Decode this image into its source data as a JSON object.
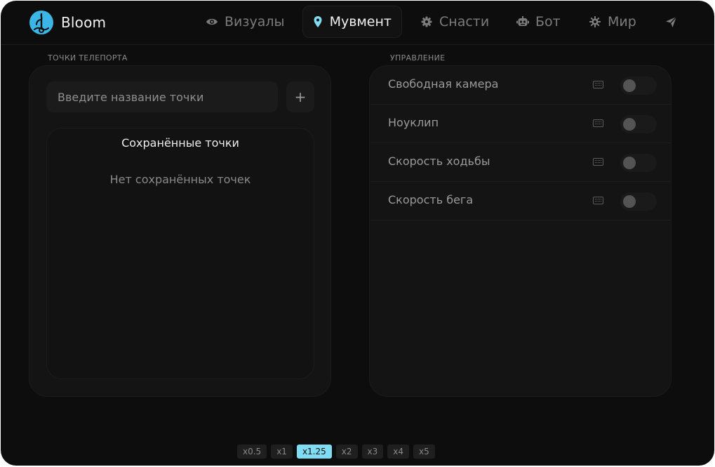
{
  "app": {
    "name": "Bloom"
  },
  "tabs": [
    {
      "label": "Визуалы",
      "icon": "eye-icon"
    },
    {
      "label": "Мувмент",
      "icon": "map-pin-icon",
      "active": true
    },
    {
      "label": "Снасти",
      "icon": "gear-icon"
    },
    {
      "label": "Бот",
      "icon": "robot-icon"
    },
    {
      "label": "Мир",
      "icon": "sun-gear-icon"
    },
    {
      "label": "",
      "icon": "send-icon"
    }
  ],
  "teleport": {
    "section_label": "ТОЧКИ ТЕЛЕПОРТА",
    "input_placeholder": "Введите название точки",
    "add_label": "+",
    "saved_title": "Сохранённые точки",
    "empty_text": "Нет сохранённых точек"
  },
  "controls": {
    "section_label": "УПРАВЛЕНИЕ",
    "items": [
      {
        "label": "Свободная камера",
        "enabled": false,
        "keybind_icon": "keyboard-icon"
      },
      {
        "label": "Ноуклип",
        "enabled": false,
        "keybind_icon": "keyboard-icon"
      },
      {
        "label": "Скорость ходьбы",
        "enabled": false,
        "keybind_icon": "keyboard-icon"
      },
      {
        "label": "Скорость бега",
        "enabled": false,
        "keybind_icon": "keyboard-icon"
      }
    ]
  },
  "speed": {
    "options": [
      "x0.5",
      "x1",
      "x1.25",
      "x2",
      "x3",
      "x4",
      "x5"
    ],
    "selected": "x1.25"
  },
  "colors": {
    "accent": "#7fdcf2",
    "background": "#0d0d0d",
    "panel": "#141414",
    "logo": "#3cb6e6"
  }
}
